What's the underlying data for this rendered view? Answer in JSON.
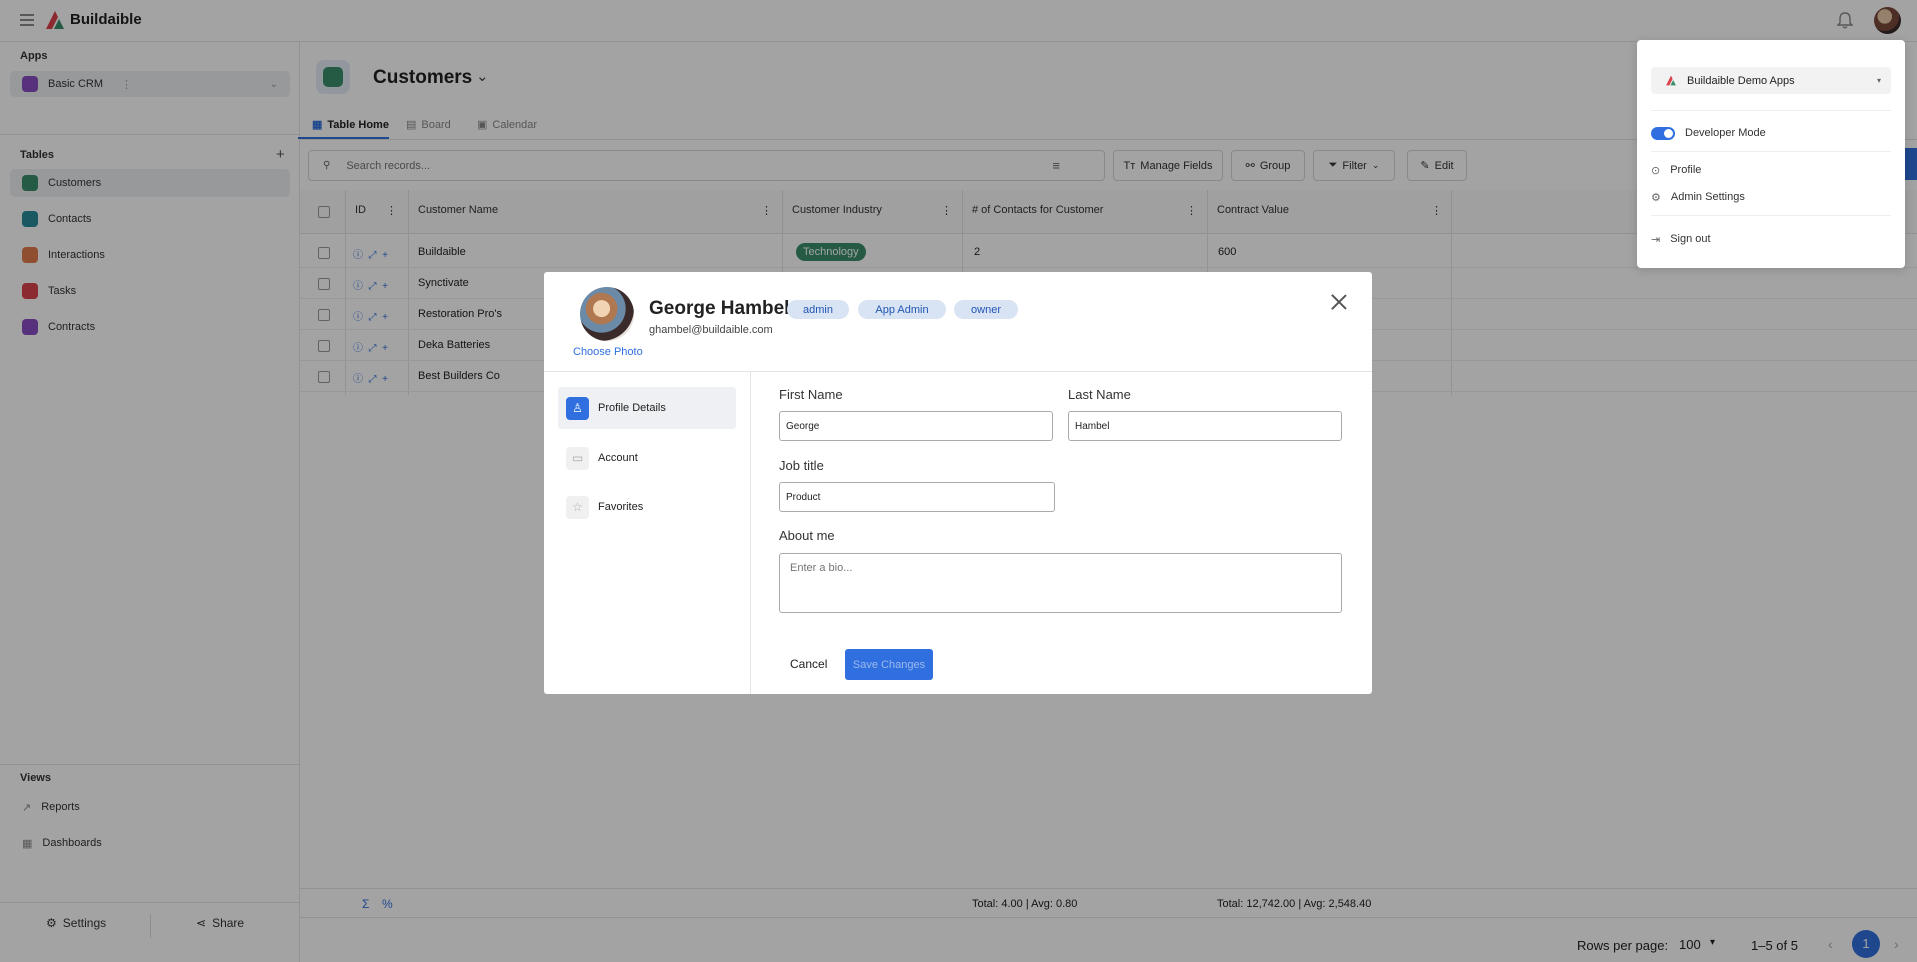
{
  "app": {
    "name": "Buildaible"
  },
  "sidebar": {
    "apps_title": "Apps",
    "app_selector": "Basic CRM",
    "tables_title": "Tables",
    "tables": [
      {
        "label": "Customers",
        "color": "#3a8f6b"
      },
      {
        "label": "Contacts",
        "color": "#2a8c9a"
      },
      {
        "label": "Interactions",
        "color": "#e07a4a"
      },
      {
        "label": "Tasks",
        "color": "#d9434b"
      },
      {
        "label": "Contracts",
        "color": "#8a4dc2"
      }
    ],
    "views_title": "Views",
    "views": [
      {
        "label": "Reports"
      },
      {
        "label": "Dashboards"
      }
    ],
    "settings_label": "Settings",
    "share_label": "Share"
  },
  "main": {
    "title": "Customers",
    "tabs": [
      {
        "label": "Table Home"
      },
      {
        "label": "Board"
      },
      {
        "label": "Calendar"
      }
    ],
    "search_placeholder": "Search records...",
    "toolbar": {
      "manage_fields": "Manage Fields",
      "group": "Group",
      "filter": "Filter",
      "edit": "Edit"
    },
    "columns": [
      "ID",
      "Customer Name",
      "Customer Industry",
      "# of Contacts for Customer",
      "Contract Value"
    ],
    "rows": [
      {
        "name": "Buildaible",
        "industry": "Technology",
        "contacts": "2",
        "value": "600"
      },
      {
        "name": "Synctivate",
        "industry": "",
        "contacts": "",
        "value": ""
      },
      {
        "name": "Restoration Pro's",
        "industry": "",
        "contacts": "",
        "value": ""
      },
      {
        "name": "Deka Batteries",
        "industry": "",
        "contacts": "",
        "value": ""
      },
      {
        "name": "Best Builders Co",
        "industry": "",
        "contacts": "",
        "value": ""
      }
    ],
    "footer": {
      "contacts_summary": "Total: 4.00 | Avg: 0.80",
      "value_summary": "Total: 12,742.00 | Avg: 2,548.40",
      "rows_per_page_label": "Rows per page:",
      "rows_per_page": "100",
      "range": "1–5 of 5",
      "page": "1"
    }
  },
  "profile_modal": {
    "name": "George Hambel",
    "email": "ghambel@buildaible.com",
    "roles": [
      "admin",
      "App Admin",
      "owner"
    ],
    "choose_photo": "Choose Photo",
    "menu": [
      {
        "label": "Profile Details"
      },
      {
        "label": "Account"
      },
      {
        "label": "Favorites"
      }
    ],
    "first_name_label": "First Name",
    "first_name": "George",
    "last_name_label": "Last Name",
    "last_name": "Hambel",
    "job_title_label": "Job title",
    "job_title": "Product",
    "about_label": "About me",
    "about_placeholder": "Enter a bio...",
    "cancel": "Cancel",
    "save": "Save Changes"
  },
  "user_menu": {
    "workspace": "Buildaible Demo Apps",
    "developer_mode": "Developer Mode",
    "profile": "Profile",
    "admin_settings": "Admin Settings",
    "sign_out": "Sign out"
  },
  "colors": {
    "accent": "#2f6fdf",
    "overlay": "rgba(0,0,0,0.36)",
    "brand_green": "#3a8f6b"
  }
}
